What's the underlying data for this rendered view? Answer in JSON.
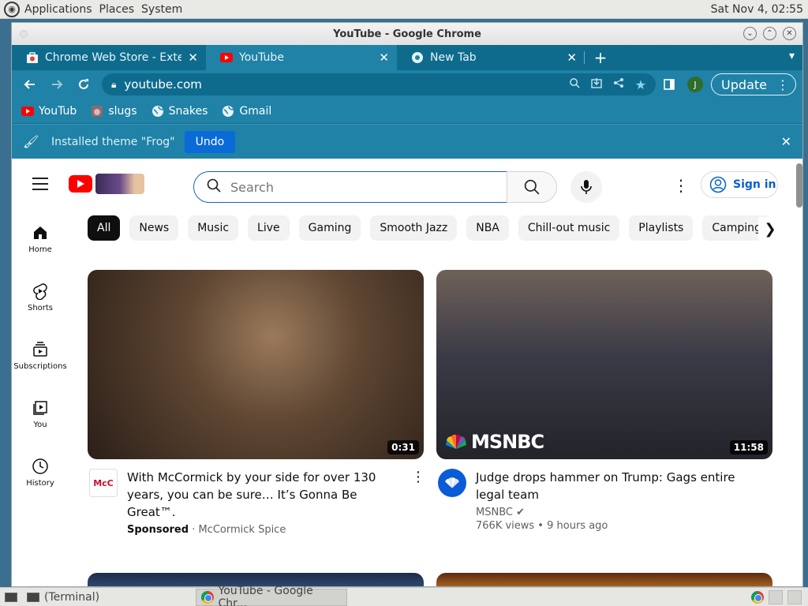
{
  "desktop": {
    "menus": [
      "Applications",
      "Places",
      "System"
    ],
    "clock": "Sat Nov  4, 02:55"
  },
  "window": {
    "title": "YouTube - Google Chrome"
  },
  "tabs": [
    {
      "label": "Chrome Web Store - Extens",
      "icon": "webstore-icon"
    },
    {
      "label": "YouTube",
      "icon": "youtube-icon"
    },
    {
      "label": "New Tab",
      "icon": "chrome-icon"
    }
  ],
  "toolbar": {
    "url": "youtube.com",
    "profile_initial": "J",
    "update_label": "Update"
  },
  "bookmarks": [
    {
      "label": "YouTub",
      "icon": "youtube-icon"
    },
    {
      "label": "slugs",
      "icon": "slug-icon"
    },
    {
      "label": "Snakes",
      "icon": "globe-icon"
    },
    {
      "label": "Gmail",
      "icon": "globe-icon"
    }
  ],
  "infobar": {
    "message": "Installed theme \"Frog\"",
    "undo_label": "Undo"
  },
  "youtube": {
    "search_placeholder": "Search",
    "sign_in_label": "Sign in",
    "guide": [
      {
        "label": "Home",
        "icon": "home-icon"
      },
      {
        "label": "Shorts",
        "icon": "shorts-icon"
      },
      {
        "label": "Subscriptions",
        "icon": "subscriptions-icon"
      },
      {
        "label": "You",
        "icon": "you-icon"
      },
      {
        "label": "History",
        "icon": "history-icon"
      }
    ],
    "chips": [
      "All",
      "News",
      "Music",
      "Live",
      "Gaming",
      "Smooth Jazz",
      "NBA",
      "Chill-out music",
      "Playlists",
      "Camping"
    ],
    "videos": [
      {
        "title": "With McCormick by your side for over 130 years, you can be sure… It’s Gonna Be Great™.",
        "sponsored_label": "Sponsored",
        "channel": "McCormick Spice",
        "duration": "0:31",
        "avatar_text": "McC"
      },
      {
        "title": "Judge drops hammer on Trump: Gags entire legal team",
        "channel": "MSNBC",
        "stats": "766K views • 9 hours ago",
        "duration": "11:58",
        "overlay": "MSNBC"
      }
    ]
  },
  "taskbar": {
    "items": [
      "(Terminal)",
      "YouTube - Google Chr..."
    ]
  }
}
